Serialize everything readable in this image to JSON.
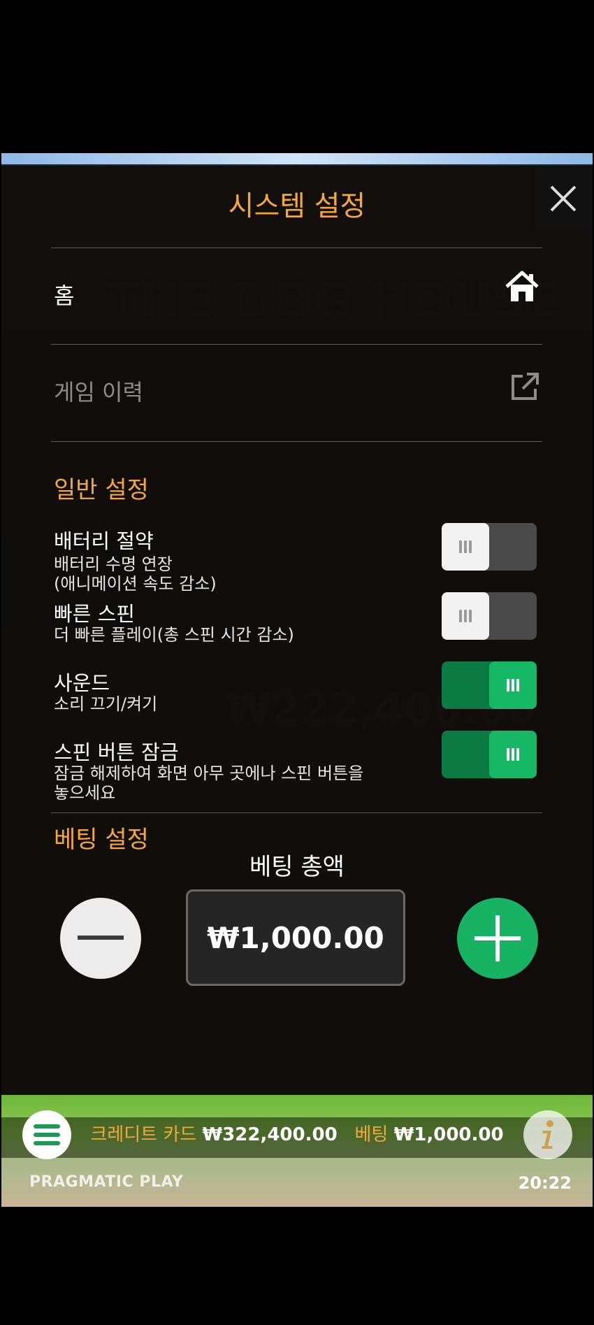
{
  "dialog": {
    "title": "시스템 설정",
    "home_label": "홈",
    "history_label": "게임 이력"
  },
  "general_settings": {
    "title": "일반 설정",
    "items": [
      {
        "title": "배터리 절약",
        "desc": "배터리 수명 연장\n(애니메이션 속도 감소)",
        "enabled": false
      },
      {
        "title": "빠른 스핀",
        "desc": "더 빠른 플레이(총 스핀 시간 감소)",
        "enabled": false
      },
      {
        "title": "사운드",
        "desc": "소리 끄기/켜기",
        "enabled": true
      },
      {
        "title": "스핀 버튼 잠금",
        "desc": "잠금 해제하여 화면 아무 곳에나 스핀 버튼을\n놓으세요",
        "enabled": true
      }
    ]
  },
  "bet_settings": {
    "title": "베팅 설정",
    "total_bet_label": "베팅 총액",
    "total_bet_value": "₩1,000.00"
  },
  "bottom_bar": {
    "credit_label": "크레디트 카드",
    "credit_value": "₩322,400.00",
    "bet_label": "베팅",
    "bet_value": "₩1,000.00",
    "brand": "PRAGMATIC PLAY",
    "time": "20:22"
  },
  "colors": {
    "accent": "#f4a83a",
    "toggle_on": "#16b865",
    "plus_button": "#17b362"
  }
}
